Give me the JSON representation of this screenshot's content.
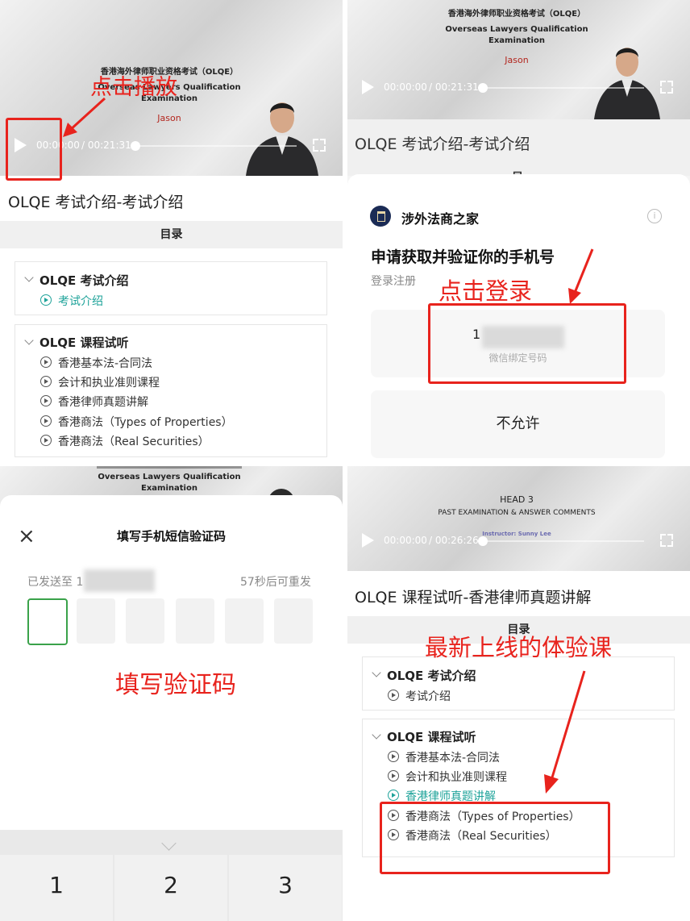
{
  "panel1": {
    "slide": {
      "cn_title": "香港海外律师职业资格考试（OLQE）",
      "en_title_1": "Overseas Lawyers Qualification",
      "en_title_2": "Examination",
      "author": "Jason"
    },
    "player": {
      "current": "00:00:00",
      "total": "/ 00:21:31"
    },
    "annotation": "点击播放",
    "course_title": "OLQE 考试介绍-考试介绍",
    "toc_label": "目录",
    "sections": [
      {
        "title": "OLQE 考试介绍",
        "items": [
          {
            "label": "考试介绍",
            "active": true
          }
        ]
      },
      {
        "title": "OLQE 课程试听",
        "items": [
          {
            "label": "香港基本法-合同法"
          },
          {
            "label": "会计和执业准则课程"
          },
          {
            "label": "香港律师真题讲解"
          },
          {
            "label": "香港商法（Types of Properties）"
          },
          {
            "label": "香港商法（Real Securities）"
          }
        ]
      }
    ]
  },
  "panel2": {
    "slide": {
      "cn_title": "香港海外律师职业资格考试（OLQE）",
      "en_title_1": "Overseas Lawyers Qualification",
      "en_title_2": "Examination",
      "author": "Jason"
    },
    "player": {
      "current": "00:00:00",
      "total": "/ 00:21:31"
    },
    "course_title": "OLQE 考试介绍-考试介绍",
    "toc_label_partial": "目",
    "dialog": {
      "app_name": "涉外法商之家",
      "heading": "申请获取并验证你的手机号",
      "subheading": "登录注册",
      "phone_partial": "1",
      "phone_caption": "微信绑定号码",
      "deny_label": "不允许",
      "info_icon": "i"
    },
    "annotation": "点击登录"
  },
  "panel3": {
    "slide": {
      "en_title_1": "Overseas Lawyers Qualification",
      "en_title_2": "Examination"
    },
    "sheet": {
      "close_icon": "×",
      "title": "填写手机短信验证码",
      "sent_to": "已发送至 1",
      "resend": "57秒后可重发"
    },
    "annotation": "填写验证码",
    "keys": [
      "1",
      "2",
      "3"
    ]
  },
  "panel4": {
    "slide": {
      "head": "HEAD 3",
      "subtitle": "PAST EXAMINATION & ANSWER COMMENTS",
      "instructor": "Instructor: Sunny Lee"
    },
    "player": {
      "current": "00:00:00",
      "total": "/ 00:26:26"
    },
    "course_title": "OLQE 课程试听-香港律师真题讲解",
    "toc_label": "目录",
    "annotation": "最新上线的体验课",
    "sections": [
      {
        "title": "OLQE 考试介绍",
        "items": [
          {
            "label": "考试介绍"
          }
        ]
      },
      {
        "title": "OLQE 课程试听",
        "items": [
          {
            "label": "香港基本法-合同法"
          },
          {
            "label": "会计和执业准则课程"
          },
          {
            "label": "香港律师真题讲解",
            "active": true
          },
          {
            "label": "香港商法（Types of Properties）"
          },
          {
            "label": "香港商法（Real Securities）"
          }
        ]
      }
    ]
  },
  "colors": {
    "accent": "#1fa39a",
    "annotation_red": "#e8231d",
    "code_box_active": "#3aa24a"
  }
}
